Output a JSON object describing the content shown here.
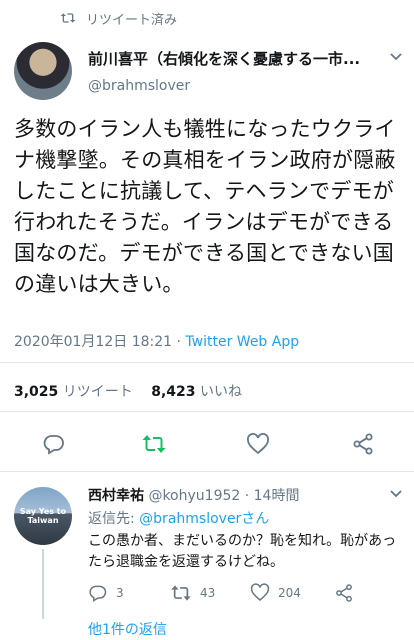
{
  "retweet": {
    "label": "リツイート済み"
  },
  "author": {
    "name": "前川喜平（右傾化を深く憂慮する一市...",
    "handle": "@brahmslover"
  },
  "tweet": {
    "text": "多数のイラン人も犠牲になったウクライナ機撃墜。その真相をイラン政府が隠蔽したことに抗議して、テヘランでデモが行われたそうだ。イランはデモができる国なのだ。デモができる国とできない国の違いは大きい。",
    "timestamp": "2020年01月12日 18:21",
    "separator": " · ",
    "source": "Twitter Web App"
  },
  "stats": {
    "retweets": "3,025",
    "retweets_label": "リツイート",
    "likes": "8,423",
    "likes_label": "いいね"
  },
  "actions": [
    "reply-icon",
    "retweet-icon",
    "like-icon",
    "share-icon"
  ],
  "reply": {
    "name": "西村幸祐",
    "handle": "@kohyu1952",
    "time": "· 14時間",
    "avatar_caption": "Say Yes to Taiwan",
    "reply_to_prefix": "返信先: ",
    "reply_to_handle": "@brahmsloverさん",
    "text": "この愚か者、まだいるのか？恥を知れ。恥があったら退職金を返還するけどね。",
    "reply_count": "3",
    "retweet_count": "43",
    "like_count": "204"
  },
  "more_replies": "他1件の返信",
  "colors": {
    "accent": "#1da1f2",
    "muted": "#657786",
    "retweet_green": "#17bf63",
    "divider": "#e1e8ed"
  }
}
